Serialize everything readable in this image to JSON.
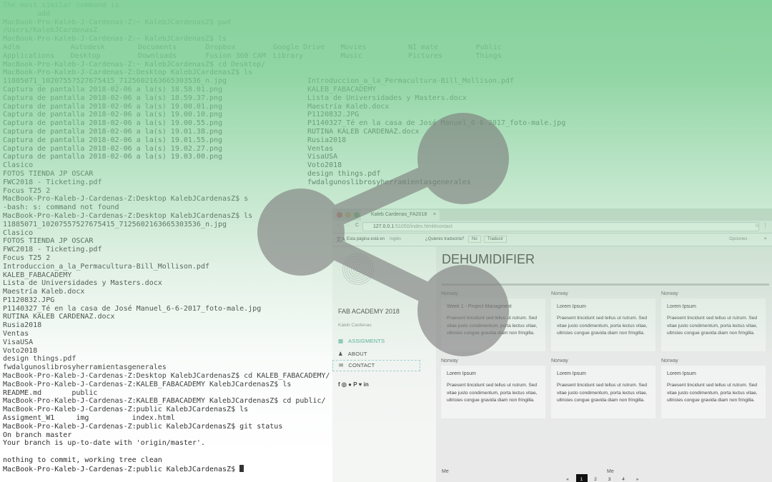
{
  "terminal": {
    "pre": [
      "The most similar command is",
      "        add",
      "MacBook-Pro-Kaleb-J-Cardenas-Z:~ KalebJCardenasZ$ pwd",
      "/Users/KalebJCardenasZ",
      "MacBook-Pro-Kaleb-J-Cardenas-Z:~ KalebJCardenasZ$ ls"
    ],
    "home_ls": [
      [
        "Adlm",
        "Autodesk",
        "Documents",
        "Dropbox",
        "Google Drive",
        "Movies",
        "NI mate",
        "Public"
      ],
      [
        "Applications",
        "Desktop",
        "Downloads",
        "Fusion 360 CAM",
        "Library",
        "Music",
        "Pictures",
        "Things"
      ]
    ],
    "mid": [
      "MacBook-Pro-Kaleb-J-Cardenas-Z:~ KalebJCardenasZ$ cd Desktop/",
      "MacBook-Pro-Kaleb-J-Cardenas-Z:Desktop KalebJCardenasZ$ ls"
    ],
    "desktop_ls": [
      [
        "11885071_10207557527675415_7125602163665303536_n.jpg",
        "Introduccion_a_la_Permacultura-Bill_Mollison.pdf"
      ],
      [
        "Captura de pantalla 2018-02-06 a la(s) 18.58.01.png",
        "KALEB_FABACADEMY"
      ],
      [
        "Captura de pantalla 2018-02-06 a la(s) 18.59.37.png",
        "Lista de Universidades y Masters.docx"
      ],
      [
        "Captura de pantalla 2018-02-06 a la(s) 19.00.01.png",
        "Maestría Kaleb.docx"
      ],
      [
        "Captura de pantalla 2018-02-06 a la(s) 19.00.10.png",
        "P1120832.JPG"
      ],
      [
        "Captura de pantalla 2018-02-06 a la(s) 19.00.55.png",
        "P1140327_Té en la casa de José Manuel_6-6-2017_foto-male.jpg"
      ],
      [
        "Captura de pantalla 2018-02-06 a la(s) 19.01.38.png",
        "RUTINA KALEB CARDENAZ.docx"
      ],
      [
        "Captura de pantalla 2018-02-06 a la(s) 19.01.55.png",
        "Rusia2018"
      ],
      [
        "Captura de pantalla 2018-02-06 a la(s) 19.02.27.png",
        "Ventas"
      ],
      [
        "Captura de pantalla 2018-02-06 a la(s) 19.03.00.png",
        "VisaUSA"
      ],
      [
        "Clasico",
        "Voto2018"
      ],
      [
        "FOTOS TIENDA JP OSCAR",
        "design things.pdf"
      ],
      [
        "FWC2018 - Ticketing.pdf",
        "fwdalgunoslibrosyherramientasgenerales"
      ],
      [
        "Focus T25 2",
        ""
      ]
    ],
    "post": [
      "MacBook-Pro-Kaleb-J-Cardenas-Z:Desktop KalebJCardenasZ$ s",
      "-bash: s: command not found",
      "MacBook-Pro-Kaleb-J-Cardenas-Z:Desktop KalebJCardenasZ$ ls",
      "11885071_10207557527675415_7125602163665303536_n.jpg",
      "Clasico",
      "FOTOS TIENDA JP OSCAR",
      "FWC2018 - Ticketing.pdf",
      "Focus T25 2",
      "Introduccion_a_la_Permacultura-Bill_Mollison.pdf",
      "KALEB_FABACADEMY",
      "Lista de Universidades y Masters.docx",
      "Maestría Kaleb.docx",
      "P1120832.JPG",
      "P1140327_Té en la casa de José Manuel_6-6-2017_foto-male.jpg",
      "RUTINA KALEB CARDENAZ.docx",
      "Rusia2018",
      "Ventas",
      "VisaUSA",
      "Voto2018",
      "design things.pdf",
      "fwdalgunoslibrosyherramientasgenerales",
      "MacBook-Pro-Kaleb-J-Cardenas-Z:Desktop KalebJCardenasZ$ cd KALEB_FABACADEMY/",
      "MacBook-Pro-Kaleb-J-Cardenas-Z:KALEB_FABACADEMY KalebJCardenasZ$ ls",
      "README.md       public",
      "MacBook-Pro-Kaleb-J-Cardenas-Z:KALEB_FABACADEMY KalebJCardenasZ$ cd public/",
      "MacBook-Pro-Kaleb-J-Cardenas-Z:public KalebJCardenasZ$ ls",
      "Assigment_W1     img          index.html",
      "MacBook-Pro-Kaleb-J-Cardenas-Z:public KalebJCardenasZ$ git status",
      "On branch master",
      "Your branch is up-to-date with 'origin/master'.",
      "",
      "nothing to commit, working tree clean"
    ],
    "prompt": "MacBook-Pro-Kaleb-J-Cardenas-Z:public KalebJCardenasZ$ "
  },
  "browser": {
    "tab_title": "Kaleb Cardenas_FA2018",
    "url_host": "127.0.0.1",
    "url_rest": ":51050/index.html#contact",
    "translate": {
      "prefix": "Esta página está en",
      "language": "Inglés",
      "question": "¿Quieres traducirla?",
      "no": "No",
      "translate": "Traducir",
      "options": "Opciones"
    },
    "sidebar": {
      "title": "FAB ACADEMY 2018",
      "subtitle": "Kaleb Cardenas",
      "nav": [
        "ASSIGMENTS",
        "ABOUT",
        "CONTACT"
      ],
      "accent": "#3aa58a"
    },
    "heading": "DEHUMIDIFIER",
    "cards": [
      {
        "img": "Norway",
        "title": "Week 1 - Project Managment",
        "text": "Praesent tincidunt sed tellus ut rutrum. Sed vitae justo condimentum, porta lectus vitae, ultricies congue gravida diam non fringilla."
      },
      {
        "img": "Norway",
        "title": "Lorem Ipsum",
        "text": "Praesent tincidunt sed tellus ut rutrum. Sed vitae justo condimentum, porta lectus vitae, ultricies congue gravida diam non fringilla."
      },
      {
        "img": "Norway",
        "title": "Lorem Ipsum",
        "text": "Praesent tincidunt sed tellus ut rutrum. Sed vitae justo condimentum, porta lectus vitae, ultricies congue gravida diam non fringilla."
      },
      {
        "img": "Norway",
        "title": "Lorem Ipsum",
        "text": "Praesent tincidunt sed tellus ut rutrum. Sed vitae justo condimentum, porta lectus vitae, ultricies congue gravida diam non fringilla."
      },
      {
        "img": "Norway",
        "title": "Lorem Ipsum",
        "text": "Praesent tincidunt sed tellus ut rutrum. Sed vitae justo condimentum, porta lectus vitae, ultricies congue gravida diam non fringilla."
      },
      {
        "img": "Norway",
        "title": "Lorem Ipsum",
        "text": "Praesent tincidunt sed tellus ut rutrum. Sed vitae justo condimentum, porta lectus vitae, ultricies congue gravida diam non fringilla."
      }
    ],
    "pagination": [
      "«",
      "1",
      "2",
      "3",
      "4",
      "»"
    ],
    "current_page": "1",
    "me_images": [
      "Me",
      "Me"
    ]
  },
  "overlay": {
    "gradient_color": "#7dce94",
    "icon": "share-icon"
  }
}
